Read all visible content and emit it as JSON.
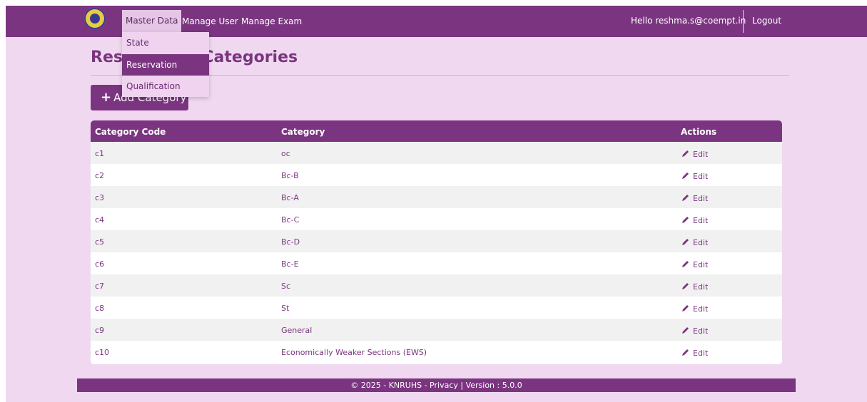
{
  "nav": {
    "items": [
      "Master Data",
      "Manage User",
      "Manage Exam"
    ],
    "greeting": "Hello reshma.s@coempt.in",
    "logout": "Logout"
  },
  "dropdown": {
    "items": [
      "State",
      "Reservation",
      "Qualification"
    ]
  },
  "page": {
    "title": "Reservation Categories",
    "add_button": "Add Category"
  },
  "table": {
    "headers": [
      "Category Code",
      "Category",
      "Actions"
    ],
    "rows": [
      {
        "code": "c1",
        "category": "oc",
        "action": "Edit"
      },
      {
        "code": "c2",
        "category": "Bc-B",
        "action": "Edit"
      },
      {
        "code": "c3",
        "category": "Bc-A",
        "action": "Edit"
      },
      {
        "code": "c4",
        "category": "Bc-C",
        "action": "Edit"
      },
      {
        "code": "c5",
        "category": "Bc-D",
        "action": "Edit"
      },
      {
        "code": "c6",
        "category": "Bc-E",
        "action": "Edit"
      },
      {
        "code": "c7",
        "category": "Sc",
        "action": "Edit"
      },
      {
        "code": "c8",
        "category": "St",
        "action": "Edit"
      },
      {
        "code": "c9",
        "category": "General",
        "action": "Edit"
      },
      {
        "code": "c10",
        "category": "Economically Weaker Sections (EWS)",
        "action": "Edit"
      }
    ]
  },
  "footer": {
    "text": "© 2025 - KNRUHS - Privacy | Version : 5.0.0"
  },
  "colors": {
    "brand": "#7b3580",
    "page_bg": "#f0d9f0",
    "row_alt": "#f1f1f1"
  },
  "icons": {
    "add": "plus-icon",
    "edit": "pencil-icon",
    "logo": "university-logo-icon"
  }
}
